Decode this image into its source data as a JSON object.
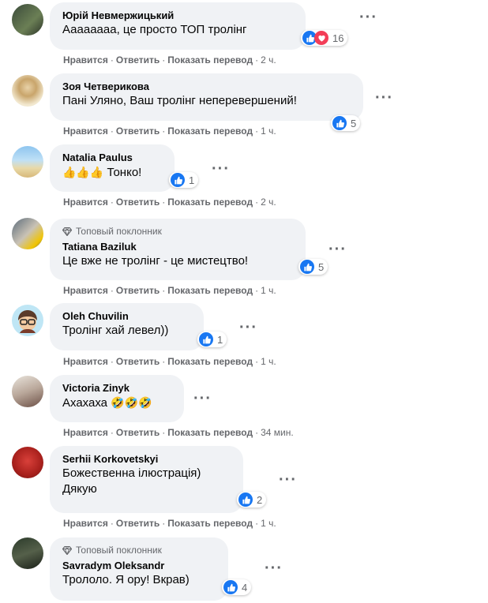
{
  "common": {
    "like": "Нравится",
    "reply": "Ответить",
    "translate": "Показать перевод",
    "sep": "·",
    "top_fan": "Топовый поклонник"
  },
  "comments": [
    {
      "name": "Юрій Невмержицький",
      "lines": [
        "Аааааааа, це просто ТОП тролінг"
      ],
      "reactions": "16",
      "time": "2 ч."
    },
    {
      "name": "Зоя Четверикова",
      "lines": [
        "Пані Уляно, Ваш тролінг неперевершений!"
      ],
      "reactions": "5",
      "time": "1 ч."
    },
    {
      "name": "Natalia Paulus",
      "lines": [
        "Тонко!"
      ],
      "emoji": "👍👍👍",
      "reactions": "1",
      "time": "2 ч."
    },
    {
      "name": "Tatiana Baziluk",
      "lines": [
        "Це вже не тролінг - це мистецтво!"
      ],
      "reactions": "5",
      "time": "1 ч."
    },
    {
      "name": "Oleh Chuvilin",
      "lines": [
        "Тролінг хай левел))"
      ],
      "reactions": "1",
      "time": "1 ч."
    },
    {
      "name": "Victoria Zinyk",
      "lines": [
        "Ахахаха"
      ],
      "emoji": "🤣🤣🤣",
      "time": "34 мин."
    },
    {
      "name": "Serhii Korkovetskyi",
      "lines": [
        "Божественна ілюстрація)",
        "Дякую"
      ],
      "reactions": "2",
      "time": "1 ч."
    },
    {
      "name": "Savradym Oleksandr",
      "lines": [
        "Трололо. Я ору! Вкрав)"
      ],
      "reactions": "4"
    }
  ]
}
